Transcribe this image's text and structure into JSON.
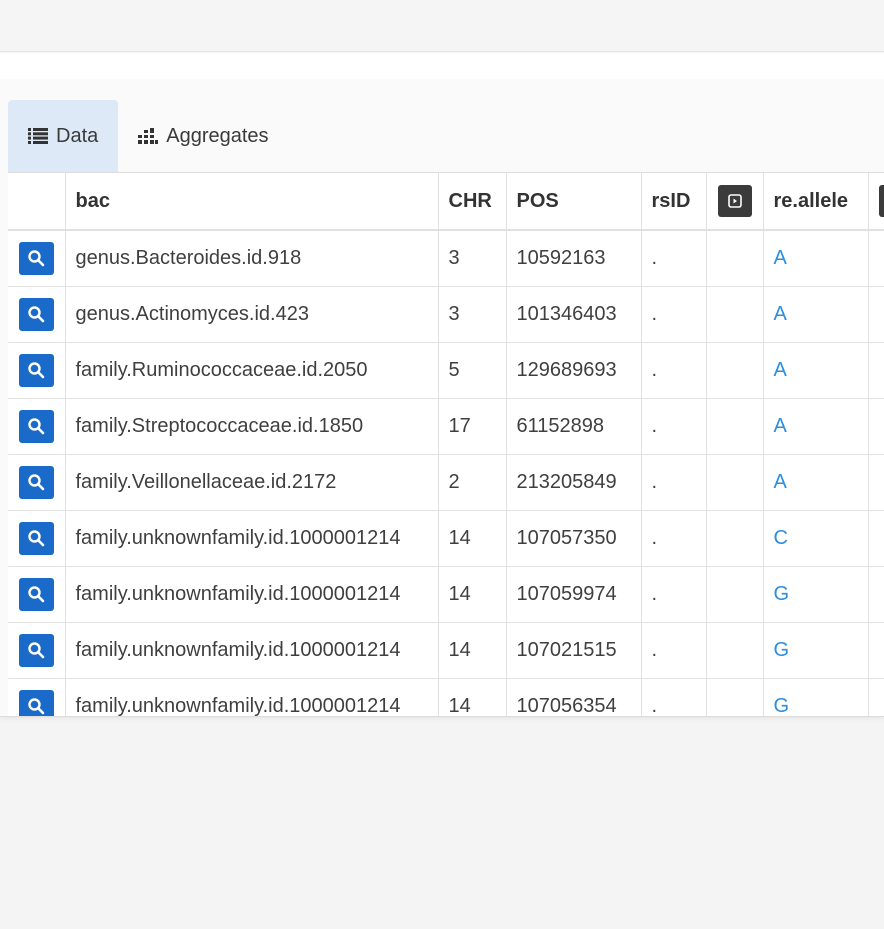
{
  "tabs": [
    {
      "label": "Data",
      "icon": "list-icon",
      "active": true
    },
    {
      "label": "Aggregates",
      "icon": "bar-chart-icon",
      "active": false
    }
  ],
  "columns": {
    "bac": "bac",
    "chr": "CHR",
    "pos": "POS",
    "rsid": "rsID",
    "re_allele": "re.allele"
  },
  "rows": [
    {
      "bac": "genus.Bacteroides.id.918",
      "chr": "3",
      "pos": "10592163",
      "rsid": ".",
      "re_allele": "A"
    },
    {
      "bac": "genus.Actinomyces.id.423",
      "chr": "3",
      "pos": "101346403",
      "rsid": ".",
      "re_allele": "A"
    },
    {
      "bac": "family.Ruminococcaceae.id.2050",
      "chr": "5",
      "pos": "129689693",
      "rsid": ".",
      "re_allele": "A"
    },
    {
      "bac": "family.Streptococcaceae.id.1850",
      "chr": "17",
      "pos": "61152898",
      "rsid": ".",
      "re_allele": "A"
    },
    {
      "bac": "family.Veillonellaceae.id.2172",
      "chr": "2",
      "pos": "213205849",
      "rsid": ".",
      "re_allele": "A"
    },
    {
      "bac": "family.unknownfamily.id.1000001214",
      "chr": "14",
      "pos": "107057350",
      "rsid": ".",
      "re_allele": "C"
    },
    {
      "bac": "family.unknownfamily.id.1000001214",
      "chr": "14",
      "pos": "107059974",
      "rsid": ".",
      "re_allele": "G"
    },
    {
      "bac": "family.unknownfamily.id.1000001214",
      "chr": "14",
      "pos": "107021515",
      "rsid": ".",
      "re_allele": "G"
    },
    {
      "bac": "family.unknownfamily.id.1000001214",
      "chr": "14",
      "pos": "107056354",
      "rsid": ".",
      "re_allele": "G"
    }
  ],
  "colors": {
    "accent": "#1a6ac9",
    "allele": "#2a8ee0",
    "active_tab": "#dde9f7",
    "dark_button": "#3b3b3b"
  }
}
